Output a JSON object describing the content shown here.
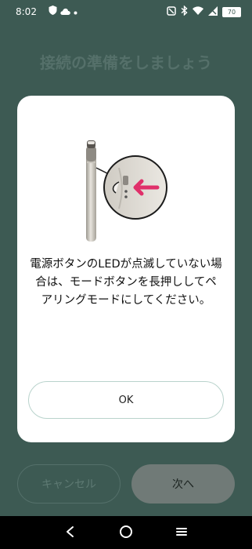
{
  "status_bar": {
    "time": "8:02",
    "battery_level": "70",
    "left_icons": [
      "shield-icon",
      "cloud-icon",
      "dot-icon"
    ],
    "right_icons": [
      "nfc-icon",
      "bluetooth-icon",
      "wifi-icon",
      "signal-icon",
      "battery-icon"
    ]
  },
  "background_screen": {
    "title": "接続の準備をしましょう",
    "cancel_label": "キャンセル",
    "next_label": "次へ"
  },
  "dialog": {
    "message": "電源ボタンのLEDが点滅していない場合は、モードボタンを長押ししてペアリングモードにしてください。",
    "ok_label": "OK",
    "illustration": "device-mode-button-illustration",
    "arrow_color": "#e0306a"
  },
  "nav_bar": {
    "buttons": [
      "back-icon",
      "home-icon",
      "recents-icon"
    ]
  },
  "colors": {
    "scrim": "#3d5a53",
    "accent_border": "#b9d3cc",
    "dialog_bg": "#ffffff"
  }
}
